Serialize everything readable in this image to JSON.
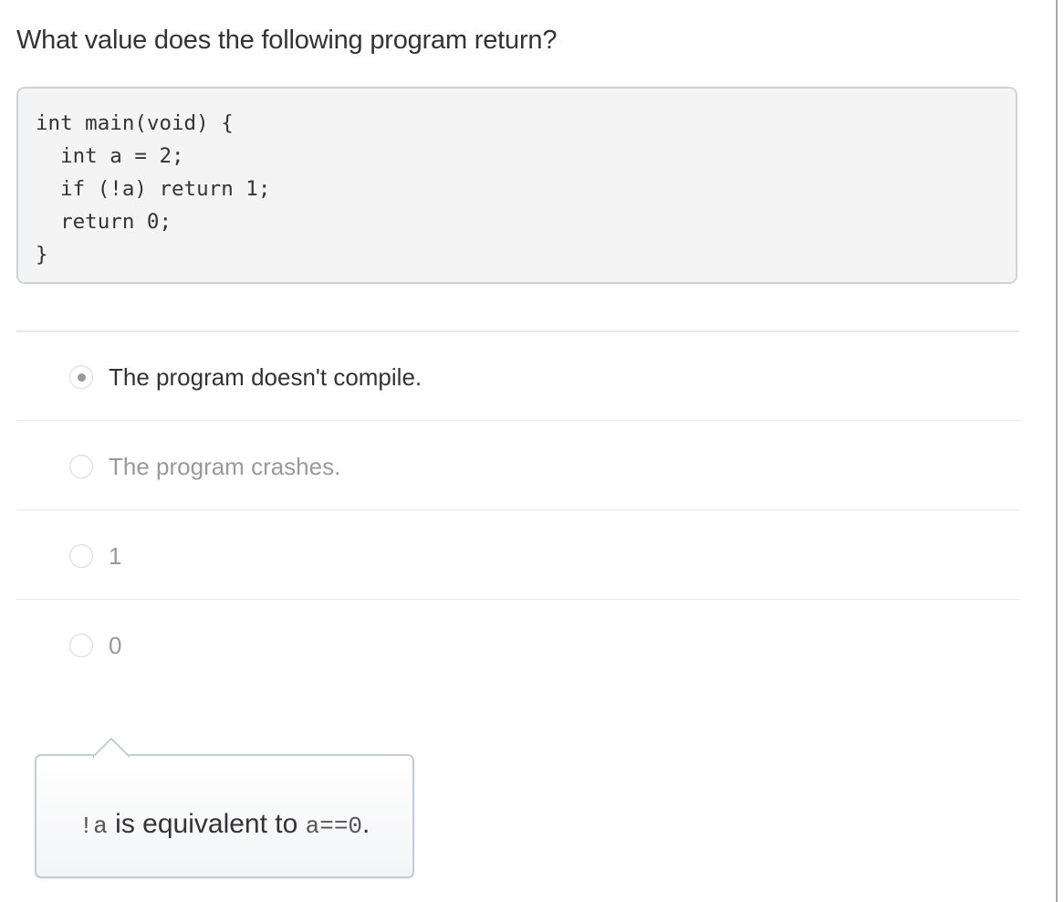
{
  "question": {
    "title": "What value does the following program return?",
    "code": "int main(void) {\n  int a = 2;\n  if (!a) return 1;\n  return 0;\n}"
  },
  "options": [
    {
      "label": "The program doesn't compile.",
      "selected": true
    },
    {
      "label": "The program crashes.",
      "selected": false
    },
    {
      "label": "1",
      "selected": false
    },
    {
      "label": "0",
      "selected": false
    }
  ],
  "tooltip": {
    "code_left": "!a",
    "middle_text": " is equivalent to ",
    "code_right": "a==0",
    "end_text": "."
  }
}
